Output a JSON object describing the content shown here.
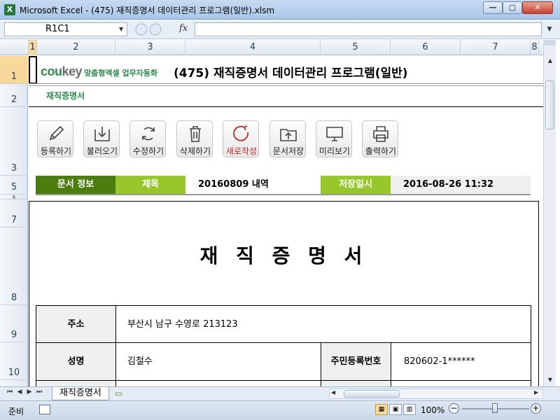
{
  "window": {
    "title": "Microsoft Excel - (475) 재직증명서 데이터관리 프로그램(일반).xlsm",
    "app_icon": "X",
    "minimize": "—",
    "maximize": "▢",
    "close": "✕"
  },
  "formula_bar": {
    "name_box": "R1C1",
    "fx_label": "fx",
    "formula": ""
  },
  "columns": [
    "1",
    "2",
    "3",
    "4",
    "5",
    "6",
    "7",
    "8"
  ],
  "rows": [
    "1",
    "2",
    "3",
    "5",
    "6",
    "7",
    "8",
    "9",
    "10"
  ],
  "brand": {
    "logo_cou": "cou",
    "logo_key": "key",
    "tagline": "맞춤형엑셀 업무자동화"
  },
  "app_title": "(475) 재직증명서 데이터관리 프로그램(일반)",
  "sheet_subtitle": "재직증명서",
  "toolbar": [
    {
      "label": "등록하기",
      "icon": "pencil-icon"
    },
    {
      "label": "불러오기",
      "icon": "download-tray-icon"
    },
    {
      "label": "수정하기",
      "icon": "refresh-icon"
    },
    {
      "label": "삭제하기",
      "icon": "trash-icon"
    },
    {
      "label": "새로작성",
      "icon": "new-refresh-icon",
      "color": "#c0282d"
    },
    {
      "label": "문서저장",
      "icon": "folder-upload-icon"
    },
    {
      "label": "미리보기",
      "icon": "monitor-icon"
    },
    {
      "label": "출력하기",
      "icon": "printer-icon"
    }
  ],
  "doc_info": {
    "label": "문서 정보",
    "title_label": "제목",
    "title_value": "20160809 내역",
    "saved_label": "저장일시",
    "saved_value": "2016-08-26 11:32"
  },
  "document": {
    "title": "재 직 증 명 서",
    "address_label": "주소",
    "address_value": "부산시 남구 수영로 213123",
    "name_label": "성명",
    "name_value": "김철수",
    "id_label": "주민등록번호",
    "id_value": "820602-1******"
  },
  "sheet_tab": "재직증명서",
  "status": {
    "ready": "준비",
    "zoom": "100%",
    "zoom_minus": "−",
    "zoom_plus": "+"
  },
  "colors": {
    "brand_green": "#2d8a4d",
    "info_dark": "#4b7d0f",
    "info_light": "#97c72a",
    "accent_red": "#c0282d"
  }
}
